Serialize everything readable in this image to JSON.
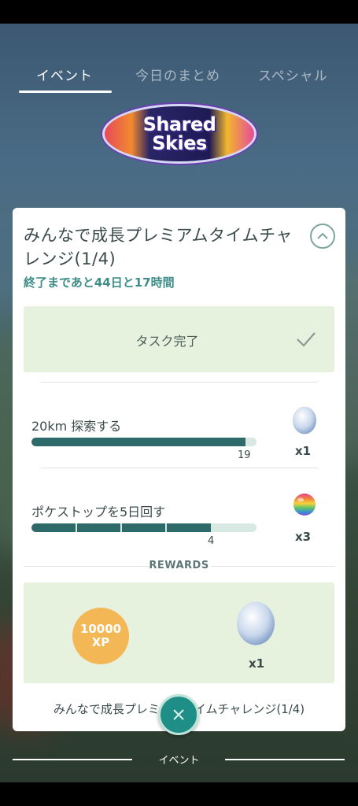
{
  "tabs": [
    {
      "label": "イベント",
      "active": true
    },
    {
      "label": "今日のまとめ",
      "active": false
    },
    {
      "label": "スペシャル",
      "active": false
    }
  ],
  "logo": {
    "line1": "Shared",
    "line2": "Skies"
  },
  "card": {
    "title": "みんなで成長プレミアムタイムチャレンジ(1/4)",
    "countdown": "終了まであと44日と17時間",
    "completed_label": "タスク完了",
    "tasks": [
      {
        "label": "20km 探索する",
        "progress_value": "19",
        "progress_fraction": 0.95,
        "reward_icon": "egg-icon",
        "reward_qty": "x1"
      },
      {
        "label": "ポケストップを5日回す",
        "progress_value": "4",
        "progress_fraction": 0.8,
        "reward_icon": "rainbow-orb-icon",
        "reward_qty": "x3"
      }
    ],
    "rewards_title": "REWARDS",
    "rewards": {
      "xp_amount": "10000",
      "xp_unit": "XP",
      "egg_qty": "x1"
    },
    "footer_title": "みんなで成長プレミアムタイムチャレンジ(1/4)"
  },
  "bottom_section_label": "イベント",
  "colors": {
    "accent": "#3e8d86",
    "progress_fill": "#2e6a6a",
    "complete_bg": "#e6f2de",
    "xp_badge": "#f3b756",
    "close_button": "#1f8e86"
  }
}
